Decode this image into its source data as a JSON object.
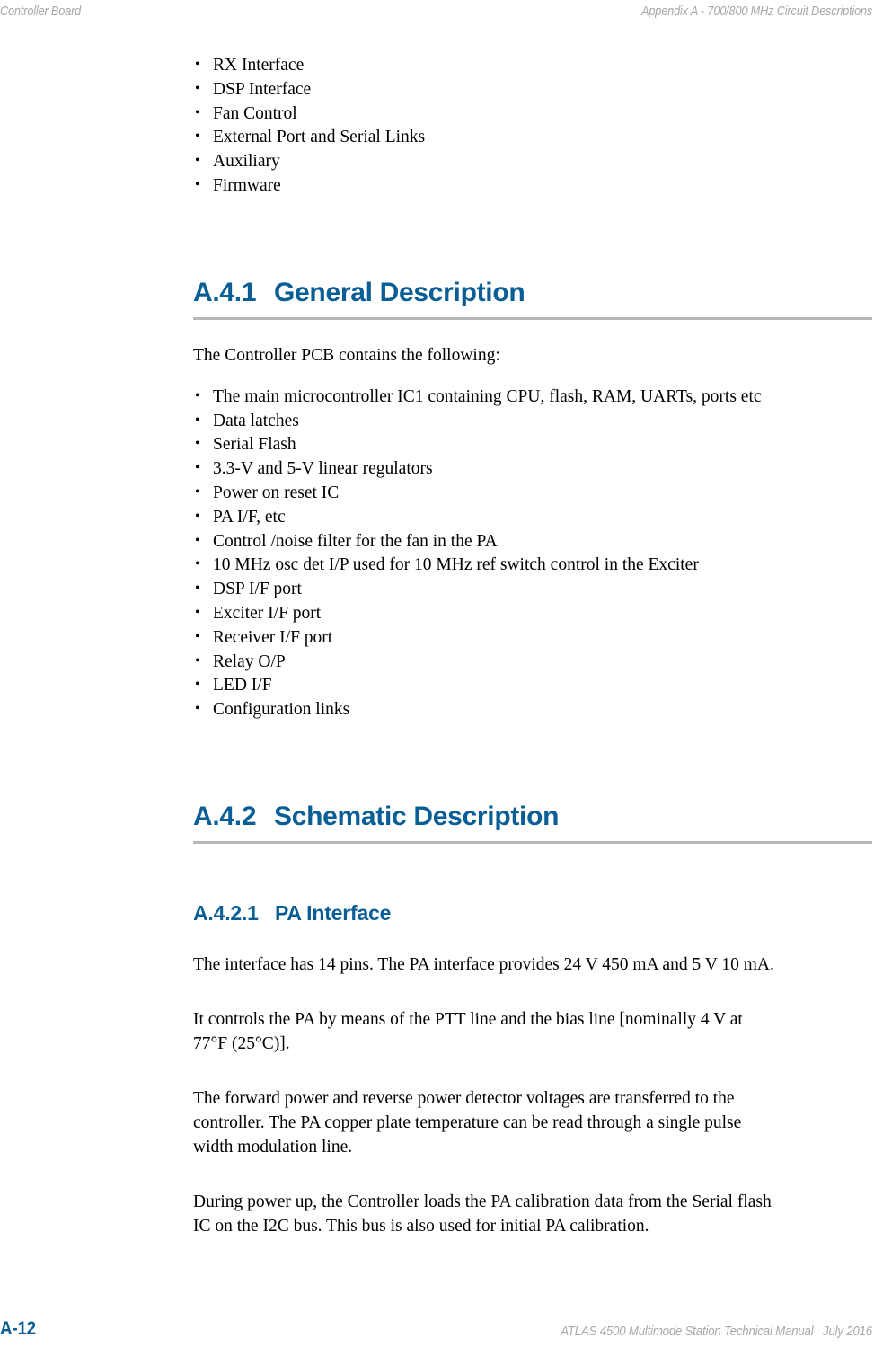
{
  "header": {
    "left": "Controller Board",
    "right": "Appendix A - 700/800 MHz Circuit Descriptions"
  },
  "top_list": {
    "items": [
      "RX Interface",
      "DSP Interface",
      "Fan Control",
      "External Port and Serial Links",
      "Auxiliary",
      "Firmware"
    ]
  },
  "section_general": {
    "number": "A.4.1",
    "title": "General Description",
    "intro": "The Controller PCB contains the following:",
    "items": [
      "The main microcontroller IC1 containing CPU, flash, RAM, UARTs, ports etc",
      "Data latches",
      "Serial Flash",
      "3.3-V and 5-V linear regulators",
      "Power on reset IC",
      "PA I/F, etc",
      "Control /noise filter for the fan in the PA",
      "10 MHz osc det I/P used for 10 MHz ref switch control in the Exciter",
      "DSP I/F port",
      "Exciter I/F port",
      "Receiver I/F port",
      "Relay O/P",
      "LED I/F",
      "Configuration links"
    ]
  },
  "section_schematic": {
    "number": "A.4.2",
    "title": "Schematic Description"
  },
  "subsection_pa": {
    "number": "A.4.2.1",
    "title": "PA Interface",
    "paragraphs": [
      {
        "lines": [
          "The interface has 14 pins. The PA interface provides 24 V 450 mA and 5 V 10 mA."
        ]
      },
      {
        "lines": [
          "It controls the PA by means of the PTT line and the bias line [nominally 4 V at",
          "77°F (25°C)]."
        ]
      },
      {
        "lines": [
          "The forward power and reverse power detector voltages are transferred to the",
          "controller. The PA copper plate temperature can be read through a single pulse",
          "width modulation line."
        ]
      },
      {
        "lines": [
          "During power up, the Controller loads the PA calibration data from the Serial flash",
          "IC on the I2C bus. This bus is also used for initial PA calibration."
        ]
      }
    ]
  },
  "footer": {
    "page_number": "A-12",
    "manual_title": "ATLAS 4500 Multimode Station Technical Manual",
    "date": "July 2016"
  },
  "colors": {
    "heading_blue": "#0a5e96",
    "rule_gray": "#b7b7b7",
    "runhead_gray": "#a8a8a8"
  }
}
